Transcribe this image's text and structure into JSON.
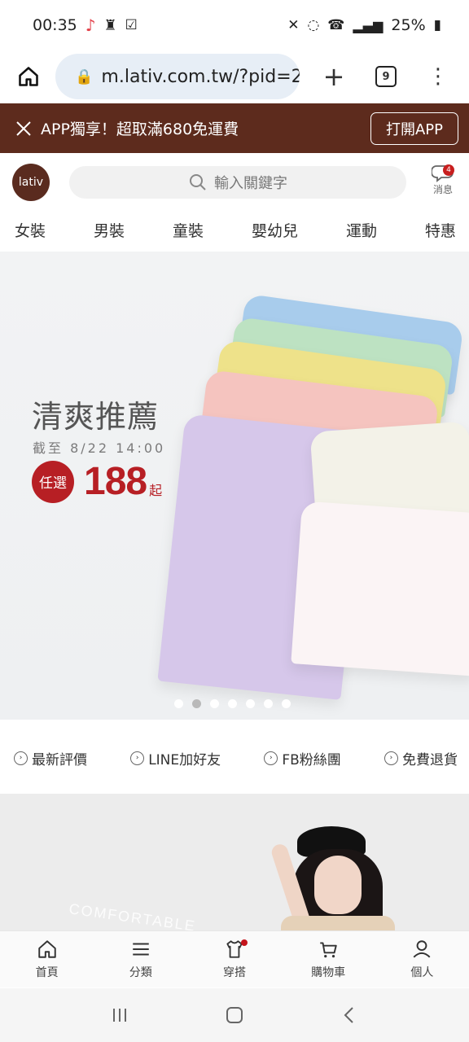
{
  "status": {
    "time": "00:35",
    "battery": "25%"
  },
  "browser": {
    "url": "m.lativ.com.tw/?pid=2",
    "tabs_count": "9"
  },
  "app_banner": {
    "text": "APP獨享！超取滿680免運費",
    "button": "打開APP",
    "bg_color": "#5d2b1d"
  },
  "header": {
    "logo": "lativ",
    "search_placeholder": "輸入關鍵字",
    "messages_label": "消息",
    "messages_badge": "4"
  },
  "categories": [
    "女裝",
    "男裝",
    "童裝",
    "嬰幼兒",
    "運動",
    "特惠"
  ],
  "hero": {
    "title": "清爽推薦",
    "date": "截至 8/22 14:00",
    "badge": "任選",
    "price": "188",
    "price_suffix": "起",
    "carousel_active_index": 1,
    "carousel_count": 7
  },
  "quick_links": [
    {
      "label": "最新評價"
    },
    {
      "label": "LINE加好友"
    },
    {
      "label": "FB粉絲團"
    },
    {
      "label": "免費退貨"
    }
  ],
  "feature": {
    "overlay_text": "COMFORTABLE"
  },
  "bottom_nav": [
    {
      "label": "首頁",
      "icon": "home-icon"
    },
    {
      "label": "分類",
      "icon": "menu-icon"
    },
    {
      "label": "穿搭",
      "icon": "shirt-icon"
    },
    {
      "label": "購物車",
      "icon": "cart-icon"
    },
    {
      "label": "個人",
      "icon": "user-icon"
    }
  ]
}
